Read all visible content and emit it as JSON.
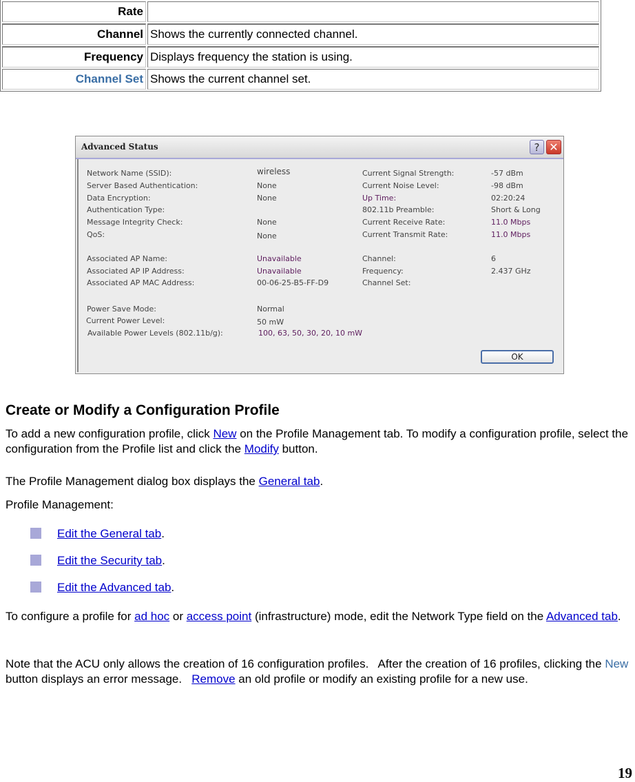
{
  "table": {
    "rows": [
      {
        "key": "Rate",
        "desc": ""
      },
      {
        "key": "Channel",
        "desc": "Shows the currently connected channel."
      },
      {
        "key": "Frequency",
        "desc": "Displays frequency the station is using."
      },
      {
        "key": "Channel Set",
        "desc": "Shows the current channel set."
      }
    ]
  },
  "dialog": {
    "title": "Advanced Status",
    "help_icon": "?",
    "close_icon": "✕",
    "left_fields": [
      {
        "label": "Network Name (SSID):",
        "value": "wireless"
      },
      {
        "label": "Server Based Authentication:",
        "value": "None"
      },
      {
        "label": "Data Encryption:",
        "value": "None"
      },
      {
        "label": "Authentication Type:",
        "value": ""
      },
      {
        "label": "Message Integrity Check:",
        "value": "None"
      },
      {
        "label": "QoS:",
        "value": "None"
      },
      {
        "label": "Associated AP Name:",
        "value": "Unavailable"
      },
      {
        "label": "Associated AP IP Address:",
        "value": "Unavailable"
      },
      {
        "label": "Associated AP MAC Address:",
        "value": "00-06-25-B5-FF-D9"
      },
      {
        "label": "Power Save Mode:",
        "value": "Normal"
      },
      {
        "label": "Current Power Level:",
        "value": "50 mW"
      },
      {
        "label": "Available Power Levels (802.11b/g):",
        "value": "100, 63, 50, 30, 20, 10 mW"
      }
    ],
    "right_fields": [
      {
        "label": "Current Signal Strength:",
        "value": "-57 dBm"
      },
      {
        "label": "Current Noise Level:",
        "value": "-98 dBm"
      },
      {
        "label": "Up Time:",
        "value": "02:20:24"
      },
      {
        "label": "802.11b Preamble:",
        "value": "Short & Long"
      },
      {
        "label": "Current Receive Rate:",
        "value": "11.0 Mbps"
      },
      {
        "label": "Current Transmit Rate:",
        "value": "11.0 Mbps"
      },
      {
        "label": "Channel:",
        "value": "6"
      },
      {
        "label": "Frequency:",
        "value": "2.437 GHz"
      },
      {
        "label": "Channel Set:",
        "value": ""
      }
    ],
    "ok_label": "OK"
  },
  "section": {
    "heading": "Create or Modify a Configuration Profile",
    "p1": {
      "t1": "To add a new configuration profile, click ",
      "link_new": "New",
      "t2": " on the Profile Management tab. To modify a configuration profile, select the configuration from the Profile list and click the ",
      "link_modify": "Modify",
      "t3": " button."
    },
    "p2": {
      "t1": "The Profile Management dialog box displays the ",
      "link_general": "General tab",
      "t2": "."
    },
    "p3": "Profile Management:",
    "bullets": [
      {
        "link": "Edit the General tab",
        "suffix": "."
      },
      {
        "link": "Edit the Security tab",
        "suffix": "."
      },
      {
        "link": "Edit the Advanced tab",
        "suffix": "."
      }
    ],
    "p4": {
      "t1": "To configure a profile for ",
      "link_adhoc": "ad hoc",
      "t2": " or ",
      "link_ap": "access point",
      "t3": " (infrastructure) mode, edit the Network Type field on the ",
      "link_advanced": "Advanced tab",
      "t4": "."
    },
    "p5": {
      "t1": "Note that the ACU only allows the creation of 16 configuration profiles.   After the creation of 16 profiles, clicking the ",
      "new_word": "New",
      "t2": " button displays an error message.   ",
      "link_remove": "Remove",
      "t3": " an old profile or modify an existing profile for a new use."
    }
  },
  "page_number": "19"
}
